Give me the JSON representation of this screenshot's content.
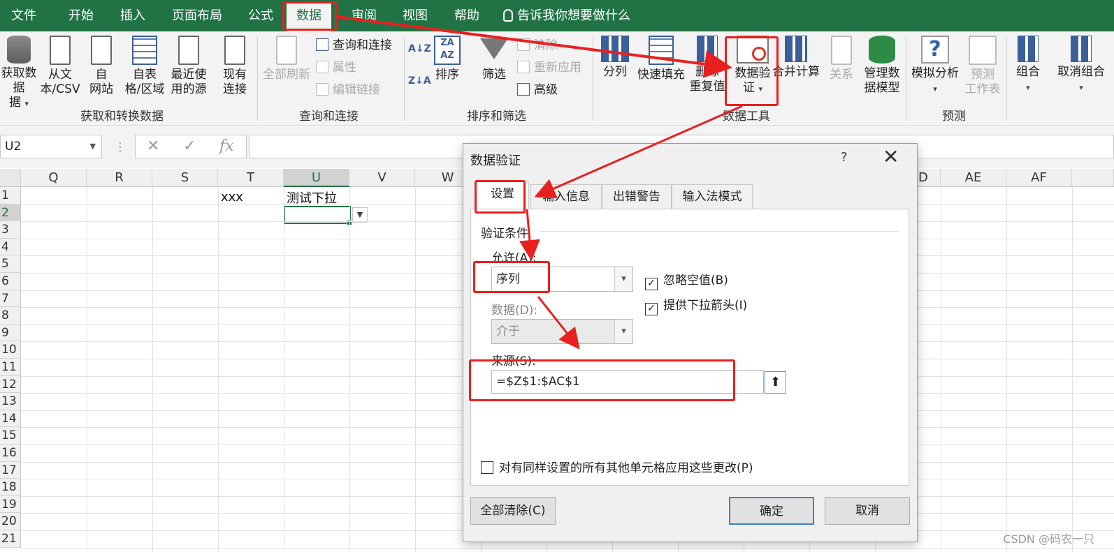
{
  "ribbon_tabs": [
    "文件",
    "开始",
    "插入",
    "页面布局",
    "公式",
    "数据",
    "审阅",
    "视图",
    "帮助"
  ],
  "tell_me": "告诉我你想要做什么",
  "ribbon": {
    "get_data": "获取数据",
    "get_data_2": "据",
    "from_text_csv": "从文",
    "from_text_csv_2": "本/CSV",
    "from_web": "自",
    "from_web_2": "网站",
    "from_table": "自表",
    "from_table_2": "格/区域",
    "recent_sources": "最近使",
    "recent_sources_2": "用的源",
    "existing_connections": "现有",
    "existing_connections_2": "连接",
    "group_get_transform": "获取和转换数据",
    "refresh_all": "全部刷新",
    "queries_connections": "查询和连接",
    "properties": "属性",
    "edit_links": "编辑链接",
    "group_queries": "查询和连接",
    "sort": "排序",
    "filter": "筛选",
    "clear": "清除",
    "reapply": "重新应用",
    "advanced": "高级",
    "group_sort_filter": "排序和筛选",
    "text_to_columns": "分列",
    "flash_fill": "快速填充",
    "remove_duplicates": "删除",
    "remove_duplicates_2": "重复值",
    "data_validation": "数据验",
    "data_validation_2": "证",
    "consolidate": "合并计算",
    "relationships": "关系",
    "manage_data_model": "管理数",
    "manage_data_model_2": "据模型",
    "group_data_tools": "数据工具",
    "what_if": "模拟分析",
    "forecast_sheet": "预测",
    "forecast_sheet_2": "工作表",
    "group_forecast": "预测",
    "group": "组合",
    "ungroup": "取消组合"
  },
  "formula_bar": {
    "name_box": "U2",
    "fx": "fx"
  },
  "sheet": {
    "columns": [
      "Q",
      "R",
      "S",
      "T",
      "U",
      "V",
      "W",
      "D",
      "AE",
      "AF"
    ],
    "rows": [
      "1",
      "2",
      "3",
      "4",
      "5",
      "6",
      "7",
      "8",
      "9",
      "10",
      "11",
      "12",
      "13",
      "14",
      "15",
      "16",
      "17",
      "18",
      "19",
      "20",
      "21"
    ],
    "cell_t1": "xxx",
    "cell_u1": "测试下拉"
  },
  "dialog": {
    "title": "数据验证",
    "help": "?",
    "tabs": [
      "设置",
      "输入信息",
      "出错警告",
      "输入法模式"
    ],
    "section": "验证条件",
    "allow_label": "允许(A):",
    "allow_value": "序列",
    "ignore_blank": "忽略空值(B)",
    "in_cell_dropdown": "提供下拉箭头(I)",
    "data_label": "数据(D):",
    "data_value": "介于",
    "source_label": "来源(S):",
    "source_value": "=$Z$1:$AC$1",
    "apply_all": "对有同样设置的所有其他单元格应用这些更改(P)",
    "clear_all": "全部清除(C)",
    "ok": "确定",
    "cancel": "取消"
  },
  "watermark": "CSDN @码农一只",
  "colors": {
    "excel_green": "#217346",
    "annotation_red": "#e8201f"
  }
}
